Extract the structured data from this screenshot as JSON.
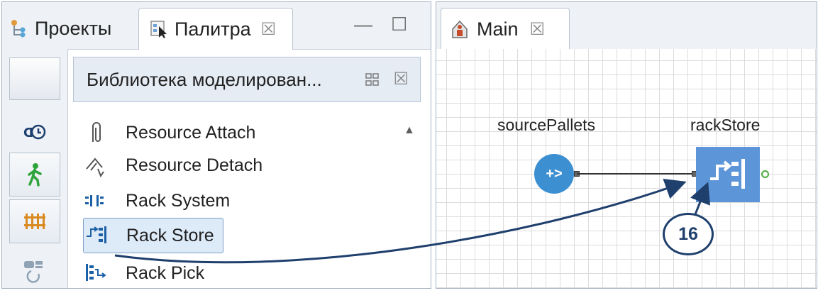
{
  "left_panel": {
    "tabs": [
      {
        "label": "Проекты",
        "icon": "projects-icon"
      },
      {
        "label": "Палитра",
        "icon": "palette-icon",
        "close": "☒"
      }
    ],
    "minimize_glyph": "—",
    "maximize_glyph": "☐",
    "library_title": "Библиотека моделирован...",
    "library_close": "☒",
    "categories": [
      "blank",
      "process-modeling-icon",
      "pedestrian-icon",
      "rail-icon",
      "fluid-icon"
    ],
    "items": [
      {
        "label": "Resource Attach",
        "icon": "paperclip-icon"
      },
      {
        "label": "Resource Detach",
        "icon": "detach-icon"
      },
      {
        "label": "Rack System",
        "icon": "rack-system-icon"
      },
      {
        "label": "Rack Store",
        "icon": "rack-store-icon",
        "selected": true
      },
      {
        "label": "Rack Pick",
        "icon": "rack-pick-icon"
      }
    ]
  },
  "right_panel": {
    "tab": {
      "label": "Main",
      "icon": "agent-icon",
      "close": "☒"
    },
    "canvas": {
      "source_label": "sourcePallets",
      "source_glyph": "+>",
      "rack_label": "rackStore"
    }
  },
  "callout": {
    "number": "16"
  },
  "colors": {
    "accent_blue": "#3c8fd0",
    "rack_blue": "#5c96d8",
    "callout_navy": "#1f3f6d",
    "out_port_green": "#4cae3c"
  }
}
